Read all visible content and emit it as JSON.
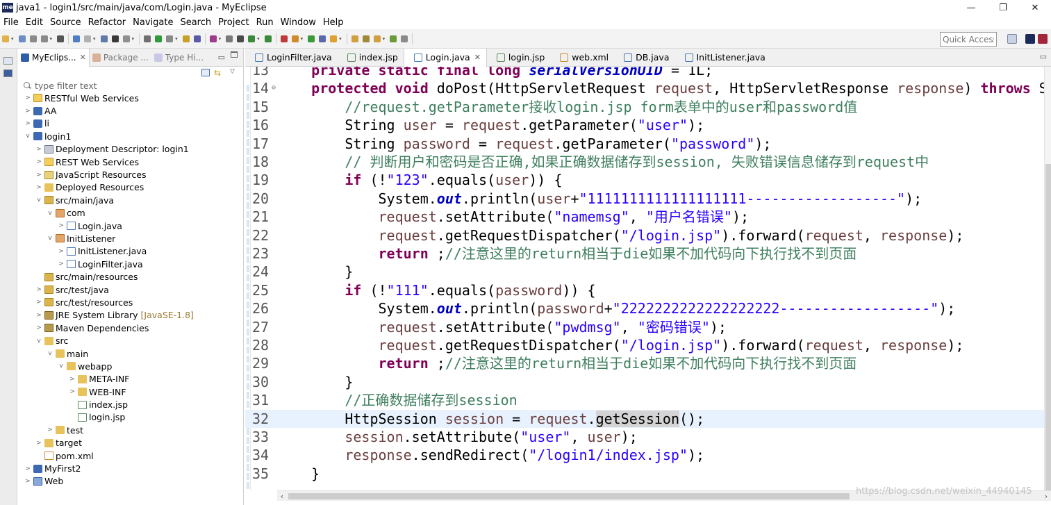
{
  "window": {
    "title": "java1 - login1/src/main/java/com/Login.java - MyEclipse",
    "logo_text": "me",
    "minimize": "—",
    "maximize": "❐",
    "close": "✕"
  },
  "menu": [
    "File",
    "Edit",
    "Source",
    "Refactor",
    "Navigate",
    "Search",
    "Project",
    "Run",
    "Window",
    "Help"
  ],
  "toolbar": {
    "quick_access_placeholder": "Quick Access"
  },
  "explorer": {
    "tabs": [
      {
        "label": "MyEclips...",
        "close": "✕"
      },
      {
        "label": "Package ..."
      },
      {
        "label": "Type Hi..."
      }
    ],
    "filter_placeholder": "type filter text",
    "tree": [
      {
        "label": "RESTful Web Services",
        "depth": 0,
        "twisty": ">",
        "icon": "rest"
      },
      {
        "label": "AA",
        "depth": 0,
        "twisty": ">",
        "icon": "proj"
      },
      {
        "label": "li",
        "depth": 0,
        "twisty": ">",
        "icon": "proj"
      },
      {
        "label": "login1",
        "depth": 0,
        "twisty": "v",
        "icon": "proj"
      },
      {
        "label": "Deployment Descriptor: login1",
        "depth": 1,
        "twisty": ">",
        "icon": "dd"
      },
      {
        "label": "REST Web Services",
        "depth": 1,
        "twisty": ">",
        "icon": "rest"
      },
      {
        "label": "JavaScript Resources",
        "depth": 1,
        "twisty": ">",
        "icon": "js"
      },
      {
        "label": "Deployed Resources",
        "depth": 1,
        "twisty": ">",
        "icon": "folder"
      },
      {
        "label": "src/main/java",
        "depth": 1,
        "twisty": "v",
        "icon": "srcfolder"
      },
      {
        "label": "com",
        "depth": 2,
        "twisty": "v",
        "icon": "pkg"
      },
      {
        "label": "Login.java",
        "depth": 3,
        "twisty": ">",
        "icon": "java"
      },
      {
        "label": "InitListener",
        "depth": 2,
        "twisty": "v",
        "icon": "pkg"
      },
      {
        "label": "InitListener.java",
        "depth": 3,
        "twisty": ">",
        "icon": "java"
      },
      {
        "label": "LoginFilter.java",
        "depth": 3,
        "twisty": ">",
        "icon": "java"
      },
      {
        "label": "src/main/resources",
        "depth": 1,
        "twisty": "",
        "icon": "srcfolder"
      },
      {
        "label": "src/test/java",
        "depth": 1,
        "twisty": ">",
        "icon": "srcfolder"
      },
      {
        "label": "src/test/resources",
        "depth": 1,
        "twisty": ">",
        "icon": "srcfolder"
      },
      {
        "label": "JRE System Library",
        "suffix": "[JavaSE-1.8]",
        "depth": 1,
        "twisty": ">",
        "icon": "lib"
      },
      {
        "label": "Maven Dependencies",
        "depth": 1,
        "twisty": ">",
        "icon": "lib"
      },
      {
        "label": "src",
        "depth": 1,
        "twisty": "v",
        "icon": "folder"
      },
      {
        "label": "main",
        "depth": 2,
        "twisty": "v",
        "icon": "folder"
      },
      {
        "label": "webapp",
        "depth": 3,
        "twisty": "v",
        "icon": "folder"
      },
      {
        "label": "META-INF",
        "depth": 4,
        "twisty": ">",
        "icon": "folder"
      },
      {
        "label": "WEB-INF",
        "depth": 4,
        "twisty": ">",
        "icon": "folder"
      },
      {
        "label": "index.jsp",
        "depth": 4,
        "twisty": "",
        "icon": "jsp"
      },
      {
        "label": "login.jsp",
        "depth": 4,
        "twisty": "",
        "icon": "jsp"
      },
      {
        "label": "test",
        "depth": 2,
        "twisty": ">",
        "icon": "folder"
      },
      {
        "label": "target",
        "depth": 1,
        "twisty": ">",
        "icon": "folder"
      },
      {
        "label": "pom.xml",
        "depth": 1,
        "twisty": "",
        "icon": "xml"
      },
      {
        "label": "MyFirst2",
        "depth": 0,
        "twisty": ">",
        "icon": "proj"
      },
      {
        "label": "Web",
        "depth": 0,
        "twisty": ">",
        "icon": "web"
      }
    ]
  },
  "editor": {
    "tabs": [
      {
        "label": "LoginFilter.java",
        "icon": "java",
        "active": false
      },
      {
        "label": "index.jsp",
        "icon": "jsp",
        "active": false
      },
      {
        "label": "Login.java",
        "icon": "java",
        "active": true,
        "close": "✕"
      },
      {
        "label": "login.jsp",
        "icon": "jsp",
        "active": false
      },
      {
        "label": "web.xml",
        "icon": "xml",
        "active": false
      },
      {
        "label": "DB.java",
        "icon": "java",
        "active": false
      },
      {
        "label": "InitListener.java",
        "icon": "java",
        "active": false
      }
    ],
    "lines": [
      {
        "n": "13",
        "tokens": [
          [
            "",
            "    "
          ],
          [
            "kw",
            "private static final long "
          ],
          [
            "fld",
            "serialVersionUID"
          ],
          [
            "",
            " = 1L;"
          ]
        ]
      },
      {
        "n": "14",
        "fold": "⊖",
        "tokens": [
          [
            "",
            "    "
          ],
          [
            "kw",
            "protected void "
          ],
          [
            "",
            "doPost(HttpServletRequest "
          ],
          [
            "var",
            "request"
          ],
          [
            "",
            ", HttpServletResponse "
          ],
          [
            "var",
            "response"
          ],
          [
            "",
            ") "
          ],
          [
            "kw",
            "throws"
          ],
          [
            "",
            " S"
          ]
        ]
      },
      {
        "n": "15",
        "tokens": [
          [
            "",
            "        "
          ],
          [
            "cm",
            "//request.getParameter接收login.jsp form表单中的user和password值"
          ]
        ]
      },
      {
        "n": "16",
        "tokens": [
          [
            "",
            "        String "
          ],
          [
            "var",
            "user"
          ],
          [
            "",
            " = "
          ],
          [
            "var",
            "request"
          ],
          [
            "",
            ".getParameter("
          ],
          [
            "str",
            "\"user\""
          ],
          [
            "",
            ");"
          ]
        ]
      },
      {
        "n": "17",
        "tokens": [
          [
            "",
            "        String "
          ],
          [
            "var",
            "password"
          ],
          [
            "",
            " = "
          ],
          [
            "var",
            "request"
          ],
          [
            "",
            ".getParameter("
          ],
          [
            "str",
            "\"password\""
          ],
          [
            "",
            ");"
          ]
        ]
      },
      {
        "n": "18",
        "tokens": [
          [
            "",
            "        "
          ],
          [
            "cm",
            "// 判断用户和密码是否正确,如果正确数据储存到session, 失败错误信息储存到request中"
          ]
        ]
      },
      {
        "n": "19",
        "tokens": [
          [
            "",
            "        "
          ],
          [
            "kw",
            "if"
          ],
          [
            "",
            " (!"
          ],
          [
            "str",
            "\"123\""
          ],
          [
            "",
            ".equals("
          ],
          [
            "var",
            "user"
          ],
          [
            "",
            ")) {"
          ]
        ]
      },
      {
        "n": "20",
        "tokens": [
          [
            "",
            "            System."
          ],
          [
            "fld",
            "out"
          ],
          [
            "",
            ".println("
          ],
          [
            "var",
            "user"
          ],
          [
            "",
            "+"
          ],
          [
            "str",
            "\"1111111111111111111------------------\""
          ],
          [
            "",
            ");"
          ]
        ]
      },
      {
        "n": "21",
        "tokens": [
          [
            "",
            "            "
          ],
          [
            "var",
            "request"
          ],
          [
            "",
            ".setAttribute("
          ],
          [
            "str",
            "\"namemsg\""
          ],
          [
            "",
            ", "
          ],
          [
            "str",
            "\"用户名错误\""
          ],
          [
            "",
            ");"
          ]
        ]
      },
      {
        "n": "22",
        "tokens": [
          [
            "",
            "            "
          ],
          [
            "var",
            "request"
          ],
          [
            "",
            ".getRequestDispatcher("
          ],
          [
            "str",
            "\"/login.jsp\""
          ],
          [
            "",
            ").forward("
          ],
          [
            "var",
            "request"
          ],
          [
            "",
            ", "
          ],
          [
            "var",
            "response"
          ],
          [
            "",
            ");"
          ]
        ]
      },
      {
        "n": "23",
        "tokens": [
          [
            "",
            "            "
          ],
          [
            "kw",
            "return"
          ],
          [
            "",
            " ;"
          ],
          [
            "cm",
            "//注意这里的return相当于die如果不加代码向下执行找不到页面"
          ]
        ]
      },
      {
        "n": "24",
        "tokens": [
          [
            "",
            "        }"
          ]
        ]
      },
      {
        "n": "25",
        "tokens": [
          [
            "",
            "        "
          ],
          [
            "kw",
            "if"
          ],
          [
            "",
            " (!"
          ],
          [
            "str",
            "\"111\""
          ],
          [
            "",
            ".equals("
          ],
          [
            "var",
            "password"
          ],
          [
            "",
            ")) {"
          ]
        ]
      },
      {
        "n": "26",
        "tokens": [
          [
            "",
            "            System."
          ],
          [
            "fld",
            "out"
          ],
          [
            "",
            ".println("
          ],
          [
            "var",
            "password"
          ],
          [
            "",
            "+"
          ],
          [
            "str",
            "\"2222222222222222222------------------\""
          ],
          [
            "",
            ");"
          ]
        ]
      },
      {
        "n": "27",
        "tokens": [
          [
            "",
            "            "
          ],
          [
            "var",
            "request"
          ],
          [
            "",
            ".setAttribute("
          ],
          [
            "str",
            "\"pwdmsg\""
          ],
          [
            "",
            ", "
          ],
          [
            "str",
            "\"密码错误\""
          ],
          [
            "",
            ");"
          ]
        ]
      },
      {
        "n": "28",
        "tokens": [
          [
            "",
            "            "
          ],
          [
            "var",
            "request"
          ],
          [
            "",
            ".getRequestDispatcher("
          ],
          [
            "str",
            "\"/login.jsp\""
          ],
          [
            "",
            ").forward("
          ],
          [
            "var",
            "request"
          ],
          [
            "",
            ", "
          ],
          [
            "var",
            "response"
          ],
          [
            "",
            ");"
          ]
        ]
      },
      {
        "n": "29",
        "tokens": [
          [
            "",
            "            "
          ],
          [
            "kw",
            "return"
          ],
          [
            "",
            " ;"
          ],
          [
            "cm",
            "//注意这里的return相当于die如果不加代码向下执行找不到页面"
          ]
        ]
      },
      {
        "n": "30",
        "tokens": [
          [
            "",
            "        }"
          ]
        ]
      },
      {
        "n": "31",
        "tokens": [
          [
            "",
            "        "
          ],
          [
            "cm",
            "//正确数据储存到session"
          ]
        ]
      },
      {
        "n": "32",
        "current": true,
        "tokens": [
          [
            "",
            "        HttpSession "
          ],
          [
            "var",
            "session"
          ],
          [
            "",
            " = "
          ],
          [
            "var",
            "request"
          ],
          [
            "",
            "."
          ],
          [
            "hl",
            "getSession"
          ],
          [
            "",
            "();"
          ]
        ]
      },
      {
        "n": "33",
        "tokens": [
          [
            "",
            "        "
          ],
          [
            "var",
            "session"
          ],
          [
            "",
            ".setAttribute("
          ],
          [
            "str",
            "\"user\""
          ],
          [
            "",
            ", "
          ],
          [
            "var",
            "user"
          ],
          [
            "",
            ");"
          ]
        ]
      },
      {
        "n": "34",
        "tokens": [
          [
            "",
            "        "
          ],
          [
            "var",
            "response"
          ],
          [
            "",
            ".sendRedirect("
          ],
          [
            "str",
            "\"/login1/index.jsp\""
          ],
          [
            "",
            ");"
          ]
        ]
      },
      {
        "n": "35",
        "tokens": [
          [
            "",
            "    }"
          ]
        ]
      }
    ]
  },
  "watermark": "https://blog.csdn.net/weixin_44940145"
}
